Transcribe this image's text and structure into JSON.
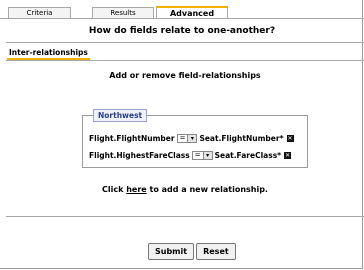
{
  "tabs": [
    {
      "label": "Criteria"
    },
    {
      "label": "Results"
    },
    {
      "label": "Advanced"
    }
  ],
  "heading": "How do fields relate to one-another?",
  "section": {
    "tab_label": "Inter-relationships",
    "subheading": "Add or remove field-relationships"
  },
  "group": {
    "legend": "Northwest",
    "rows": [
      {
        "left": "Flight.FlightNumber",
        "operator": "=",
        "right": "Seat.FlightNumber*"
      },
      {
        "left": "Flight.HighestFareClass",
        "operator": "=",
        "right": "Seat.FareClass*"
      }
    ]
  },
  "add": {
    "prefix": "Click",
    "link": "here",
    "suffix": "to add a new relationship."
  },
  "buttons": {
    "submit": "Submit",
    "reset": "Reset"
  }
}
